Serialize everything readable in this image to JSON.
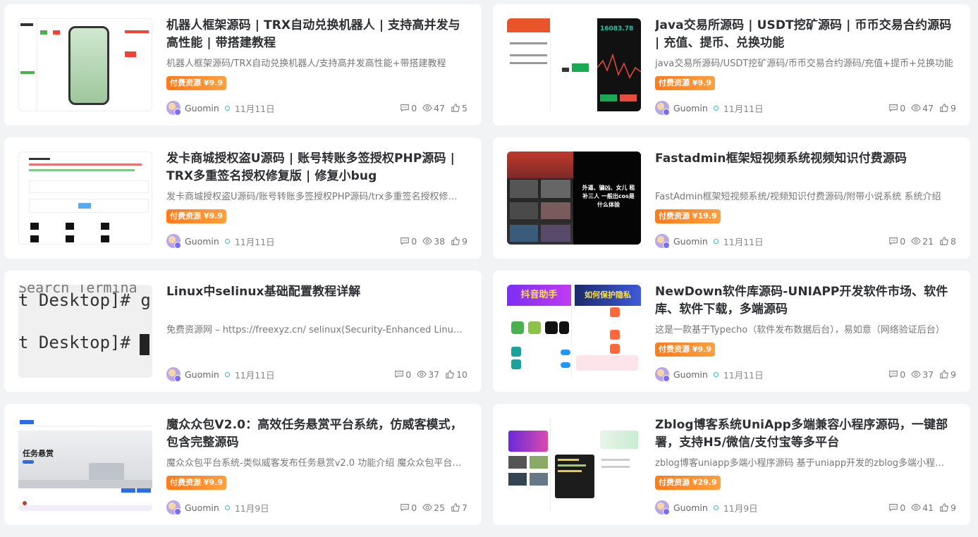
{
  "cards": [
    {
      "title": "机器人框架源码 | TRX自动兑换机器人 | 支持高并发与高性能 | 带搭建教程",
      "desc": "机器人框架源码/TRX自动兑换机器人/支持高并发高性能+带搭建教程",
      "badge": "付费资源 ¥9.9",
      "author": "Guomin",
      "date": "11月11日",
      "comments": "0",
      "views": "47",
      "likes": "5"
    },
    {
      "title": "Java交易所源码 | USDT挖矿源码 | 币币交易合约源码 | 充值、提币、兑换功能",
      "desc": "java交易所源码/USDT挖矿源码/币币交易合约源码/充值+提币+兑换功能",
      "badge": "付费资源 ¥9.9",
      "author": "Guomin",
      "date": "11月11日",
      "comments": "0",
      "views": "47",
      "likes": "9"
    },
    {
      "title": "发卡商城授权盗U源码 | 账号转账多签授权PHP源码 | TRX多重签名授权修复版 | 修复小bug",
      "desc": "发卡商城授权盗U源码/账号转账多签授权PHP源码/trx多重签名授权修复版",
      "badge": "付费资源 ¥9.9",
      "author": "Guomin",
      "date": "11月11日",
      "comments": "0",
      "views": "38",
      "likes": "9"
    },
    {
      "title": "Fastadmin框架短视频系统视频知识付费源码",
      "desc": "FastAdmin框架短视频系统/视频知识付费源码/附带小说系统 系统介绍",
      "badge": "付费资源 ¥19.9",
      "author": "Guomin",
      "date": "11月11日",
      "comments": "0",
      "views": "21",
      "likes": "8"
    },
    {
      "title": "Linux中selinux基础配置教程详解",
      "desc": "免费资源网 – https://freexyz.cn/ selinux(Security-Enhanced Linux)是美国国家安全局",
      "badge": "",
      "author": "Guomin",
      "date": "11月11日",
      "comments": "0",
      "views": "37",
      "likes": "10"
    },
    {
      "title": "NewDown软件库源码-UNIAPP开发软件市场、软件库、软件下载，多端源码",
      "desc": "这是一款基于Typecho（软件发布数据后台），易如意（网络验证后台）",
      "badge": "付费资源 ¥9.9",
      "author": "Guomin",
      "date": "11月11日",
      "comments": "0",
      "views": "37",
      "likes": "9"
    },
    {
      "title": "魔众众包V2.0：高效任务悬赏平台系统，仿威客模式，包含完整源码",
      "desc": "魔众众包平台系统-类似威客发布任务悬赏v2.0 功能介绍 魔众众包平台系统",
      "badge": "付费资源 ¥9.9",
      "author": "Guomin",
      "date": "11月9日",
      "comments": "0",
      "views": "25",
      "likes": "7"
    },
    {
      "title": "Zblog博客系统UniApp多端兼容小程序源码，一键部署，支持H5/微信/支付宝等多平台",
      "desc": "zblog博客uniapp多端小程序源码 基于uniapp开发的zblog多端小程序源码",
      "badge": "付费资源 ¥29.9",
      "author": "Guomin",
      "date": "11月9日",
      "comments": "0",
      "views": "41",
      "likes": "9"
    }
  ],
  "thumb_text": {
    "c2_price": "16083.78",
    "c4_overlay": "外逼、骗凶、女儿 租补三人 一般出cos是什么体验",
    "c5_line1": "Search   Termina",
    "c5_line2": "t Desktop]# g",
    "c5_line3": "t Desktop]# ",
    "c6_banner1": "抖音助手",
    "c6_banner2": "如何保护隐私",
    "c7_banner": "任务悬赏"
  },
  "colors": {
    "accent": "#ff7a1a",
    "link": "#3bb8c9"
  }
}
